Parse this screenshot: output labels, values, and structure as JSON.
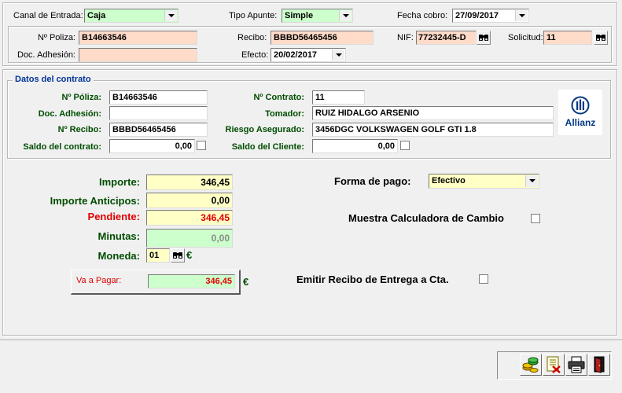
{
  "header": {
    "canal_entrada_label": "Canal de Entrada:",
    "canal_entrada_value": "Caja",
    "tipo_apunte_label": "Tipo Apunte:",
    "tipo_apunte_value": "Simple",
    "fecha_cobro_label": "Fecha cobro:",
    "fecha_cobro_value": "27/09/2017",
    "poliza_label": "Nº Poliza:",
    "poliza_value": "B14663546",
    "recibo_label": "Recibo:",
    "recibo_value": "BBBD56465456",
    "nif_label": "NIF:",
    "nif_value": "77232445-D",
    "solicitud_label": "Solicitud:",
    "solicitud_value": "11",
    "doc_adhesion_label": "Doc. Adhesión:",
    "doc_adhesion_value": "",
    "efecto_label": "Efecto:",
    "efecto_value": "20/02/2017"
  },
  "contrato": {
    "title": "Datos del contrato",
    "poliza_label": "Nº Póliza:",
    "poliza_value": "B14663546",
    "doc_adhesion_label": "Doc. Adhesión:",
    "doc_adhesion_value": "",
    "recibo_label": "Nº Recibo:",
    "recibo_value": "BBBD56465456",
    "saldo_contrato_label": "Saldo del contrato:",
    "saldo_contrato_value": "0,00",
    "contrato_label": "Nº Contrato:",
    "contrato_value": "11",
    "tomador_label": "Tomador:",
    "tomador_value": "RUIZ HIDALGO ARSENIO",
    "riesgo_label": "Riesgo Asegurado:",
    "riesgo_value": "3456DGC VOLKSWAGEN GOLF GTI 1.8",
    "saldo_cliente_label": "Saldo del Cliente:",
    "saldo_cliente_value": "0,00",
    "logo_text": "Allianz"
  },
  "pago": {
    "importe_label": "Importe:",
    "importe_value": "346,45",
    "anticipos_label": "Importe Anticipos:",
    "anticipos_value": "0,00",
    "pendiente_label": "Pendiente:",
    "pendiente_value": "346,45",
    "minutas_label": "Minutas:",
    "minutas_value": "0,00",
    "moneda_label": "Moneda:",
    "moneda_value": "01",
    "currency_symbol": "€",
    "va_a_pagar_label": "Va a Pagar:",
    "va_a_pagar_value": "346,45",
    "forma_pago_label": "Forma de pago:",
    "forma_pago_value": "Efectivo",
    "calculadora_label": "Muestra Calculadora de Cambio",
    "emitir_recibo_label": "Emitir Recibo de Entrega a Cta."
  },
  "colors": {
    "label_green": "#004d00",
    "pendiente_red": "#e00000",
    "group_title_blue": "#003399",
    "logo_blue": "#003781"
  },
  "toolbar": {
    "icons": [
      "coins-icon",
      "cancel-document-icon",
      "printer-icon",
      "exit-door-icon"
    ]
  }
}
